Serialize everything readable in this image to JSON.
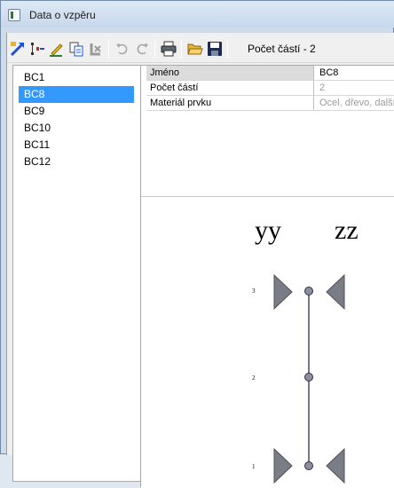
{
  "window": {
    "title": "Data o vzpěru"
  },
  "toolbar": {
    "label": "Počet částí - 2",
    "buttons": [
      {
        "name": "new-icon"
      },
      {
        "name": "split-icon"
      },
      {
        "name": "edit-icon"
      },
      {
        "name": "copy-icon"
      },
      {
        "name": "delete-icon"
      },
      {
        "name": "undo-icon"
      },
      {
        "name": "redo-icon"
      },
      {
        "name": "print-icon"
      },
      {
        "name": "open-icon"
      },
      {
        "name": "save-icon"
      }
    ]
  },
  "list": {
    "items": [
      {
        "label": "BC1",
        "selected": false
      },
      {
        "label": "BC8",
        "selected": true
      },
      {
        "label": "BC9",
        "selected": false
      },
      {
        "label": "BC10",
        "selected": false
      },
      {
        "label": "BC11",
        "selected": false
      },
      {
        "label": "BC12",
        "selected": false
      }
    ]
  },
  "properties": {
    "rows": [
      {
        "label": "Jméno",
        "value": "BC8",
        "dim": false
      },
      {
        "label": "Počet částí",
        "value": "2",
        "dim": true
      },
      {
        "label": "Materiál prvku",
        "value": "Ocel, dřevo, další",
        "dim": true
      }
    ]
  },
  "diagram": {
    "labels": {
      "yy": "yy",
      "zz": "zz"
    },
    "nodes": [
      "3",
      "2",
      "1"
    ],
    "line_color": "#2c2c54",
    "support_color": "#7a7d86"
  }
}
